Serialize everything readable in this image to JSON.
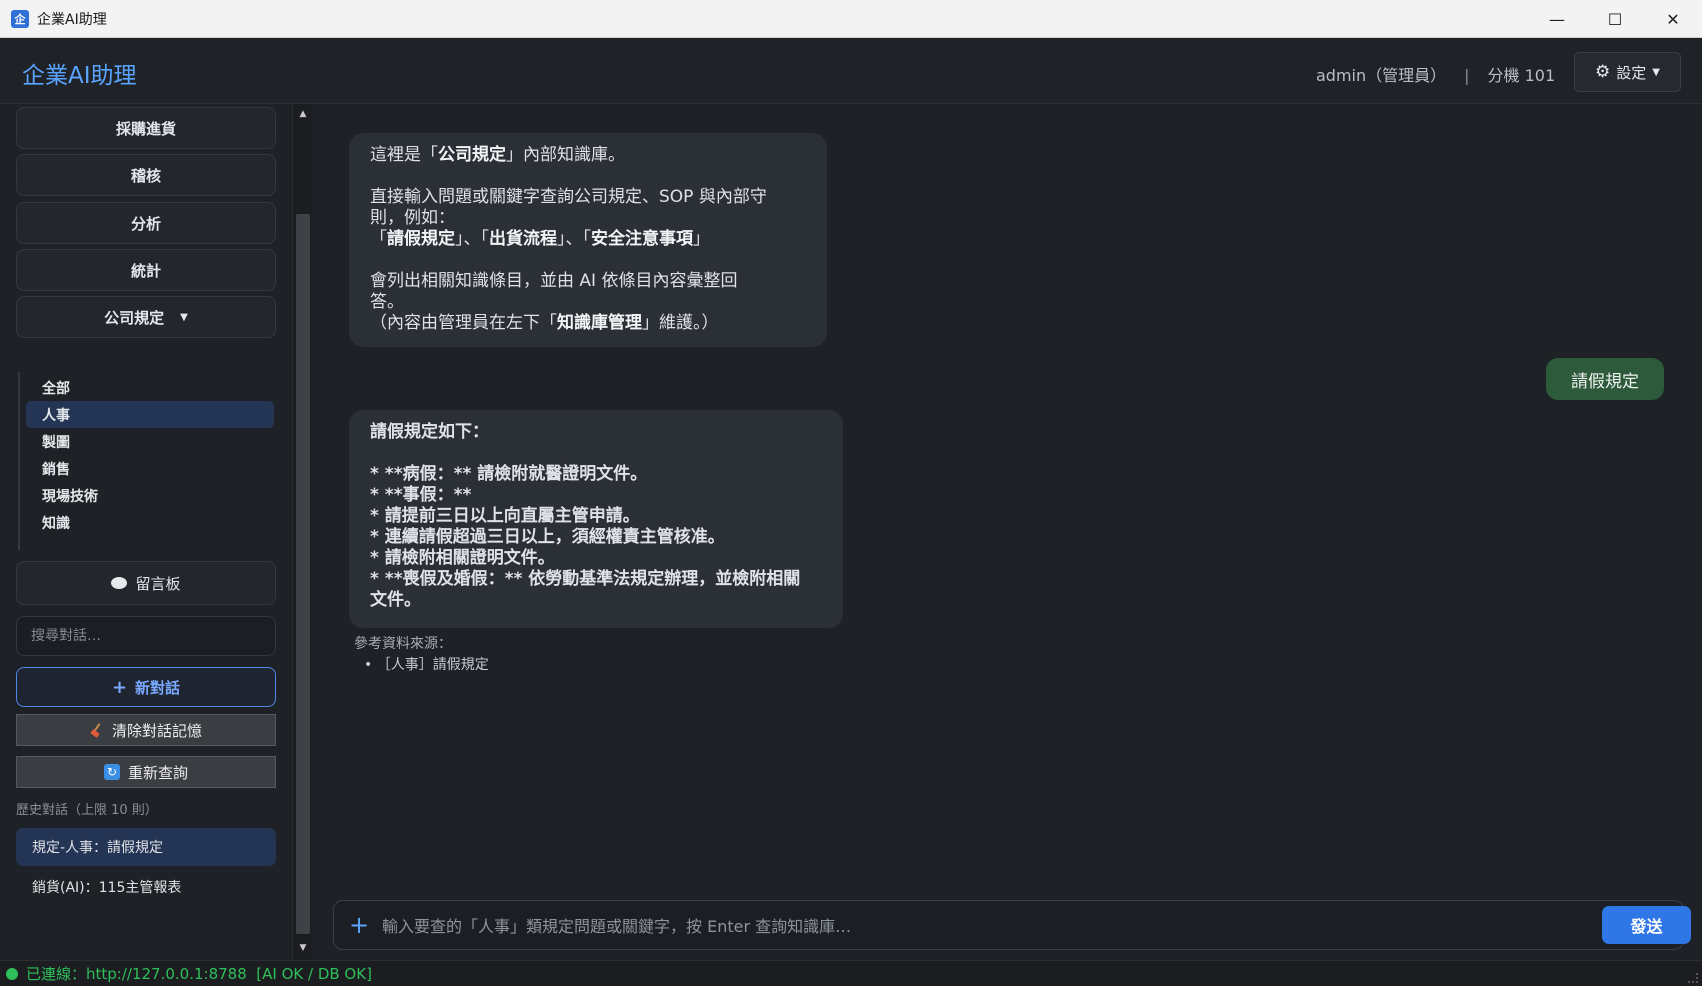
{
  "window": {
    "icon_glyph": "企",
    "title": "企業AI助理",
    "controls": [
      "minimize-icon",
      "maximize-icon",
      "close-icon"
    ]
  },
  "header": {
    "brand": "企業AI助理",
    "user": "admin（管理員）",
    "separator": "|",
    "extension": "分機 101",
    "settings_label": "設定"
  },
  "sidebar": {
    "nav": [
      "採購進貨",
      "稽核",
      "分析",
      "統計"
    ],
    "regulations_label": "公司規定",
    "sub_items": [
      "全部",
      "人事",
      "製圖",
      "銷售",
      "現場技術",
      "知識"
    ],
    "active_sub_index": 1,
    "message_board": "留言板",
    "search_placeholder": "搜尋對話…",
    "new_chat": "新對話",
    "clear_memory": "清除對話記憶",
    "requery": "重新查詢",
    "history_label": "歷史對話（上限 10 則）",
    "history": [
      "規定-人事：請假規定",
      "銷貨(AI)：115主管報表"
    ],
    "active_history_index": 0
  },
  "chat": {
    "intro": {
      "l1_pre": "這裡是「",
      "l1_bold": "公司規定",
      "l1_post": "」內部知識庫。",
      "l2": "直接輸入問題或關鍵字查詢公司規定、SOP 與內部守",
      "l3": "則，例如：",
      "l4_a": "「",
      "l4_b": "請假規定",
      "l4_c": "」、「",
      "l4_d": "出貨流程",
      "l4_e": "」、「",
      "l4_f": "安全注意事項",
      "l4_g": "」",
      "l5": "會列出相關知識條目，並由 AI 依條目內容彙整回",
      "l6": "答。",
      "l7_pre": "（內容由管理員在左下「",
      "l7_bold": "知識庫管理",
      "l7_post": "」維護。）"
    },
    "user_message": "請假規定",
    "answer": {
      "heading": "請假規定如下：",
      "lines": [
        "* **病假：** 請檢附就醫證明文件。",
        "* **事假：**",
        "* 請提前三日以上向直屬主管申請。",
        "* 連續請假超過三日以上，須經權責主管核准。",
        "* 請檢附相關證明文件。",
        "* **喪假及婚假：** 依勞動基準法規定辦理，並檢附相關",
        "文件。"
      ]
    },
    "sources_label": "參考資料來源：",
    "source_item": "• ［人事］請假規定",
    "input_placeholder": "輸入要查的「人事」類規定問題或關鍵字，按 Enter 查詢知識庫…",
    "send_label": "發送"
  },
  "status": {
    "text": "已連線：http://127.0.0.1:8788  [AI OK / DB OK]",
    "color": "#2fbf5a"
  },
  "colors": {
    "accent": "#5aa4ff",
    "send": "#2f77e6",
    "user_bubble": "#2c5a3a",
    "active_item": "#243454"
  }
}
